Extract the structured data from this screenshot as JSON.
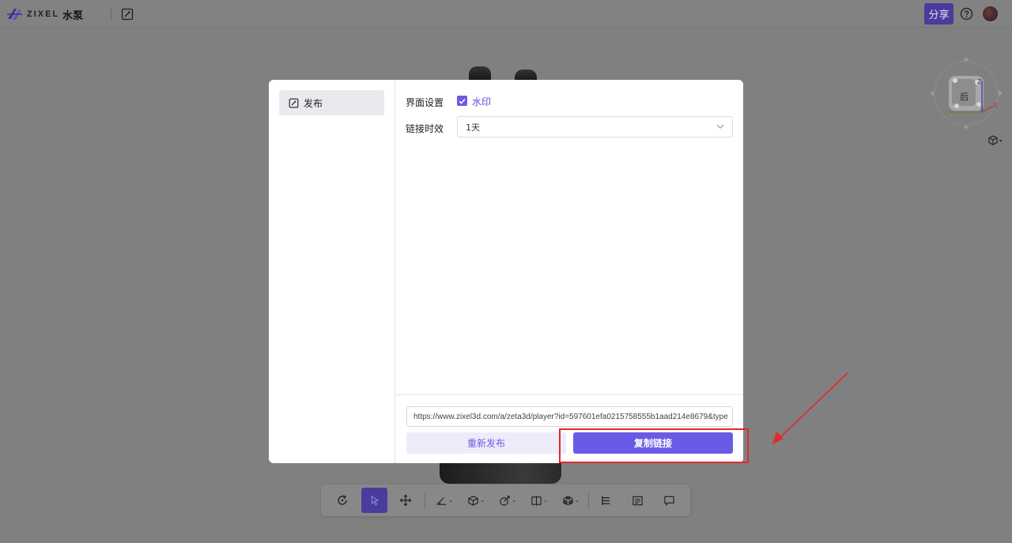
{
  "topbar": {
    "logo_text": "ZIXEL",
    "project_name": "水泵",
    "share_label": "分享"
  },
  "modal": {
    "sidebar": {
      "items": [
        {
          "label": "发布",
          "icon": "edit-icon",
          "selected": true
        }
      ]
    },
    "settings": {
      "ui_settings_label": "界面设置",
      "watermark_label": "水印",
      "watermark_checked": true,
      "link_expiry_label": "链接时效",
      "link_expiry_value": "1天"
    },
    "footer": {
      "url": "https://www.zixel3d.com/a/zeta3d/player?id=597601efa0215758555b1aad214e8679&type",
      "republish_label": "重新发布",
      "copy_link_label": "复制链接"
    }
  },
  "viewcube": {
    "face_label": "后",
    "axis_labels": [
      "Z",
      "Y",
      "X"
    ]
  },
  "toolbar": {
    "tools": [
      "rotate-tool",
      "select-tool",
      "move-tool",
      "measure-tool",
      "section-tool",
      "explode-tool",
      "split-view-tool",
      "display-mode-tool",
      "structure-tree-tool",
      "properties-tool",
      "comment-tool"
    ]
  },
  "colors": {
    "accent": "#6a5be5",
    "share_button_dimmed": "#4a3c9c",
    "annotation_red": "#e4282a",
    "overlay": "#808080"
  }
}
